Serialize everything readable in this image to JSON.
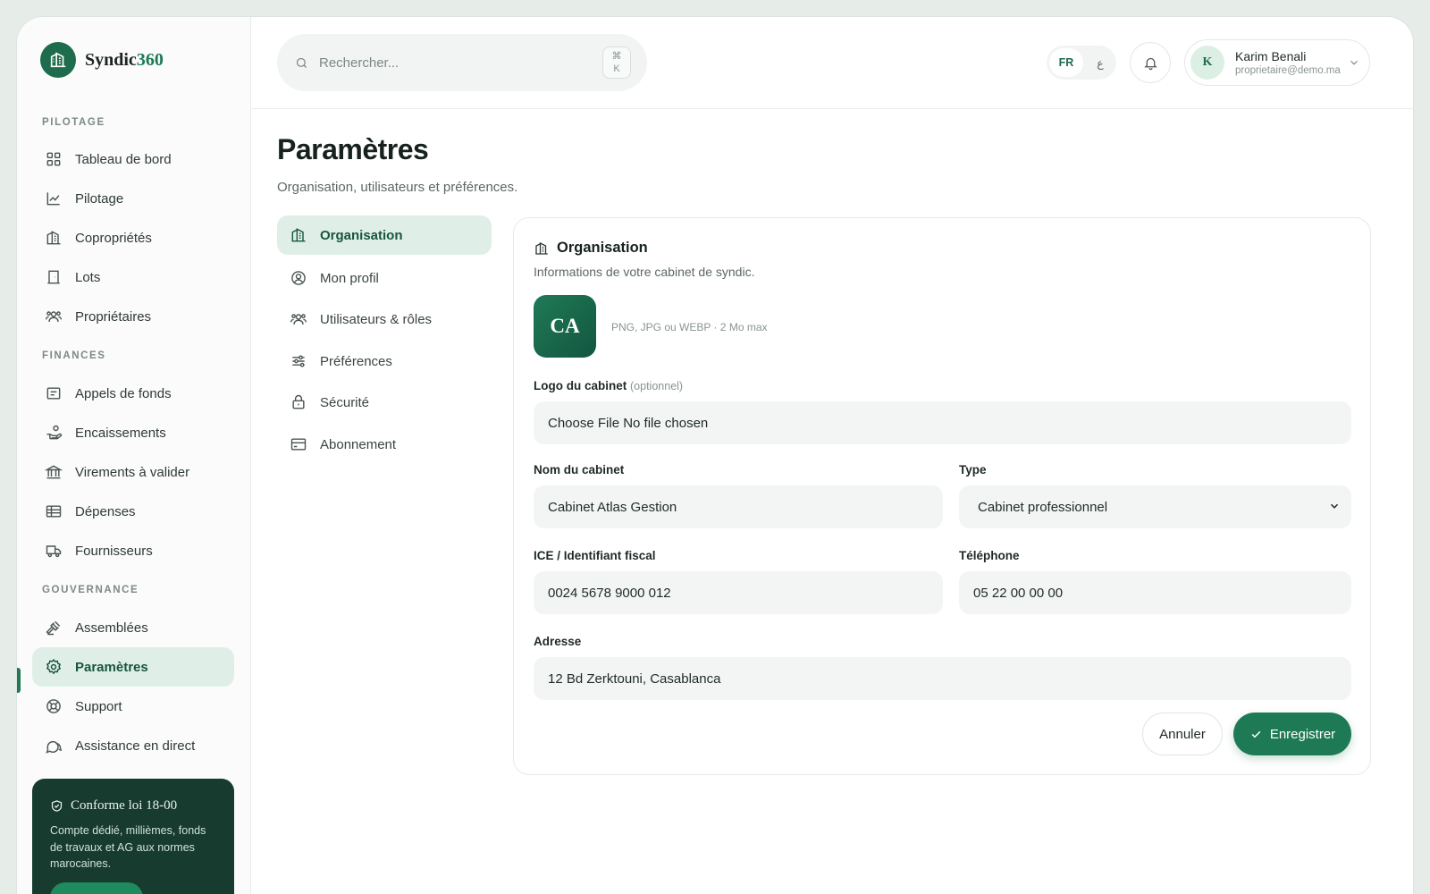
{
  "brand": {
    "name_main": "Syndic",
    "name_accent": "360"
  },
  "sidebar": {
    "sections": [
      {
        "label": "PILOTAGE"
      },
      {
        "label": "FINANCES"
      },
      {
        "label": "GOUVERNANCE"
      }
    ],
    "items": [
      {
        "label": "Tableau de bord",
        "icon": "grid-icon"
      },
      {
        "label": "Pilotage",
        "icon": "chart-line-icon"
      },
      {
        "label": "Copropriétés",
        "icon": "building-icon"
      },
      {
        "label": "Lots",
        "icon": "door-icon"
      },
      {
        "label": "Propriétaires",
        "icon": "users-icon"
      },
      {
        "label": "Appels de fonds",
        "icon": "receipt-icon"
      },
      {
        "label": "Encaissements",
        "icon": "hand-coins-icon"
      },
      {
        "label": "Virements à valider",
        "icon": "bank-icon"
      },
      {
        "label": "Dépenses",
        "icon": "list-icon"
      },
      {
        "label": "Fournisseurs",
        "icon": "truck-icon"
      },
      {
        "label": "Assemblées",
        "icon": "gavel-icon"
      },
      {
        "label": "Paramètres",
        "icon": "gear-icon",
        "active": true
      },
      {
        "label": "Support",
        "icon": "lifebuoy-icon"
      },
      {
        "label": "Assistance en direct",
        "icon": "chat-icon"
      }
    ],
    "promo": {
      "title": "Conforme loi 18-00",
      "text": "Compte dédié, millièmes, fonds de travaux et AG aux normes marocaines."
    }
  },
  "topbar": {
    "search_placeholder": "Rechercher...",
    "shortcut_symbol": "⌘",
    "shortcut_key": "K",
    "lang_fr": "FR",
    "lang_ar": "ع",
    "user": {
      "initial": "K",
      "name": "Karim Benali",
      "email": "proprietaire@demo.ma"
    }
  },
  "page": {
    "title": "Paramètres",
    "subtitle": "Organisation, utilisateurs et préférences."
  },
  "subnav": [
    {
      "label": "Organisation",
      "icon": "building-icon",
      "active": true
    },
    {
      "label": "Mon profil",
      "icon": "user-circle-icon"
    },
    {
      "label": "Utilisateurs & rôles",
      "icon": "users-icon"
    },
    {
      "label": "Préférences",
      "icon": "sliders-icon"
    },
    {
      "label": "Sécurité",
      "icon": "lock-icon"
    },
    {
      "label": "Abonnement",
      "icon": "credit-card-icon"
    }
  ],
  "card": {
    "title": "Organisation",
    "subtitle": "Informations de votre cabinet de syndic.",
    "logo_initials": "CA",
    "logo_hint": "PNG, JPG ou WEBP · 2 Mo max",
    "logo_label": "Logo du cabinet",
    "logo_optional": "(optionnel)",
    "file_input_text": "Choose File No file chosen",
    "name_label": "Nom du cabinet",
    "name_value": "Cabinet Atlas Gestion",
    "type_label": "Type",
    "type_value": "Cabinet professionnel",
    "ice_label": "ICE / Identifiant fiscal",
    "ice_value": "0024 5678 9000 012",
    "phone_label": "Téléphone",
    "phone_value": "05 22 00 00 00",
    "address_label": "Adresse",
    "address_value": "12 Bd Zerktouni, Casablanca",
    "cancel_label": "Annuler",
    "save_label": "Enregistrer"
  },
  "colors": {
    "accent": "#1e7a55",
    "accent_light": "#dfefe7",
    "promo_bg": "#173b2e"
  }
}
